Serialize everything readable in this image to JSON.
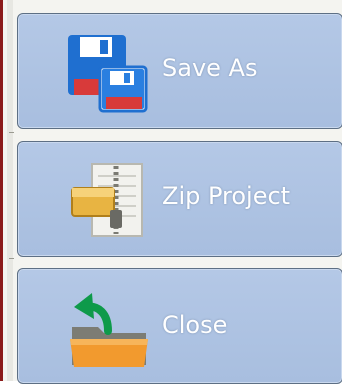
{
  "menu": {
    "items": [
      {
        "id": "save-as",
        "label": "Save As",
        "icon": "floppy-disks-icon"
      },
      {
        "id": "zip-project",
        "label": "Zip Project",
        "icon": "zip-archive-icon"
      },
      {
        "id": "close",
        "label": "Close",
        "icon": "folder-back-arrow-icon"
      }
    ]
  },
  "colors": {
    "button_bg": "#a8bedf",
    "button_border": "#5d6f84",
    "label_text": "#ffffff",
    "accent_frame": "#8b1a1a"
  }
}
